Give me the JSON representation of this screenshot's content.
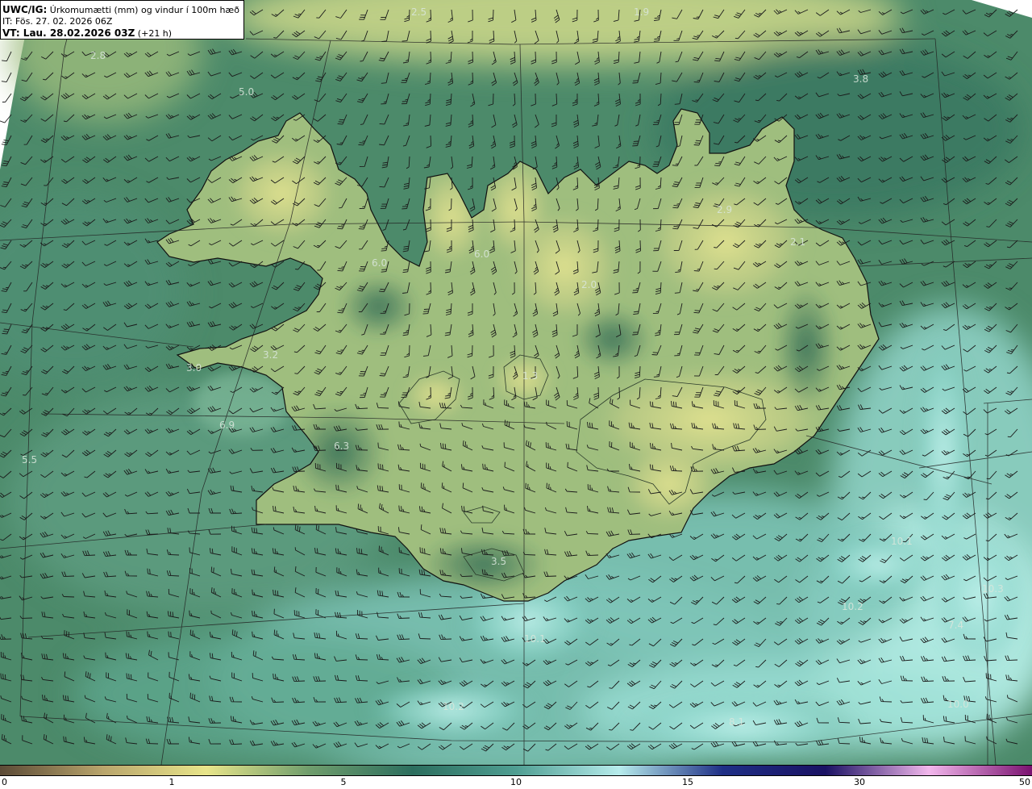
{
  "header": {
    "product_label": "UWC/IG:",
    "title_text": " Úrkomumætti (mm) og vindur í 100m hæð",
    "init_line": "IT: Fös. 27. 02. 2026 06Z",
    "valid_label": "VT: Lau. 28.02.2026 03Z",
    "valid_offset": " (+21 h)"
  },
  "colorbar": {
    "ticks": [
      "0",
      "1",
      "5",
      "10",
      "15",
      "30",
      "50"
    ],
    "colors": [
      "#5b4a36",
      "#b9a56c",
      "#e8e58a",
      "#6f9d6c",
      "#2c6e5e",
      "#4f9e92",
      "#b7ecec",
      "#1f2f86",
      "#1a1163",
      "#f2b7ec",
      "#7a1270"
    ]
  },
  "map": {
    "field_colors": {
      "ocean_dark": "#3e7a62",
      "ocean_mid": "#5f9b73",
      "ocean_light": "#8ad3c9",
      "land_yellow": "#c6d487",
      "highland_green": "#93b57a"
    },
    "value_labels": [
      "2.5",
      "1.9",
      "2.8",
      "5.0",
      "3.8",
      "2.9",
      "2.1",
      "6.0",
      "6.0",
      "2.0",
      "3.2",
      "3.0",
      "1.3",
      "6.9",
      "6.3",
      "5.5",
      "10.1",
      "3.5",
      "10.2",
      "10.1",
      "7.4",
      "10.2",
      "10.0",
      "8.1",
      "10.3"
    ]
  }
}
